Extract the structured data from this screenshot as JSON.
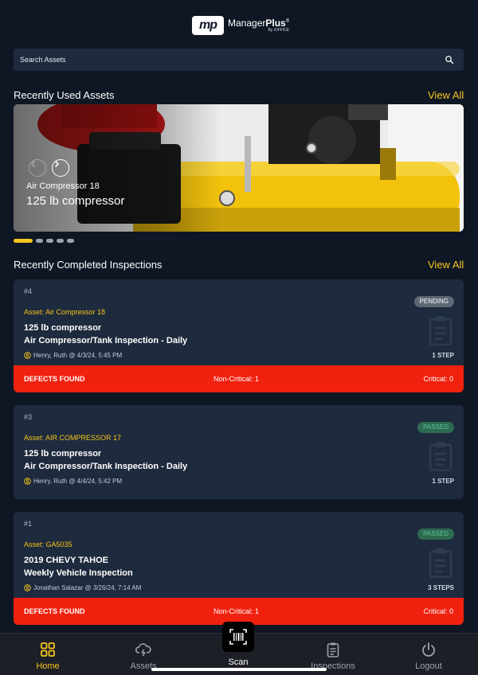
{
  "brand": {
    "mark": "mp",
    "name_light": "Manager",
    "name_bold": "Plus",
    "reg": "®",
    "byline": "By iOFFICE"
  },
  "search": {
    "placeholder": "Search Assets"
  },
  "recent_assets": {
    "title": "Recently Used Assets",
    "view_all": "View All",
    "slide": {
      "subtitle": "Air Compressor 18",
      "title": "125 lb compressor"
    },
    "pagination": {
      "count": 5,
      "active": 0
    }
  },
  "recent_inspections": {
    "title": "Recently Completed Inspections",
    "view_all": "View All",
    "cards": [
      {
        "number": "#4",
        "asset": "Asset: Air Compressor 18",
        "line1": "125 lb compressor",
        "line2": "Air Compressor/Tank Inspection - Daily",
        "meta": "Henry, Ruth @ 4/3/24, 5:45 PM",
        "status": "PENDING",
        "steps": "1 STEP",
        "defects": {
          "label": "DEFECTS FOUND",
          "non_critical": "Non-Critical: 1",
          "critical": "Critical: 0"
        }
      },
      {
        "number": "#3",
        "asset": "Asset: AIR COMPRESSOR 17",
        "line1": "125 lb compressor",
        "line2": "Air Compressor/Tank Inspection - Daily",
        "meta": "Henry, Ruth @ 4/4/24, 5:42 PM",
        "status": "PASSED",
        "steps": "1 STEP"
      },
      {
        "number": "#1",
        "asset": "Asset: GA5035",
        "line1": "2019 CHEVY TAHOE",
        "line2": "Weekly Vehicle Inspection",
        "meta": "Jonathan Salazar @ 3/26/24, 7:14 AM",
        "status": "PASSED",
        "steps": "3 STEPS",
        "defects": {
          "label": "DEFECTS FOUND",
          "non_critical": "Non-Critical: 1",
          "critical": "Critical: 0"
        }
      }
    ]
  },
  "tabs": {
    "home": "Home",
    "assets": "Assets",
    "scan": "Scan",
    "inspections": "Inspections",
    "logout": "Logout"
  },
  "colors": {
    "background": "#0f1725",
    "card": "#1e2a3d",
    "accent": "#f5c51b",
    "defects": "#f0210f",
    "passed": "#5ec490"
  },
  "icons": {
    "search": "search-icon",
    "next": "chevron-right-icon",
    "prev": "chevron-left-icon",
    "user": "user-circle-icon",
    "clipboard": "clipboard-icon",
    "home": "grid-icon",
    "assets": "cloud-lightning-icon",
    "scan": "barcode-icon",
    "inspections": "clipboard-list-icon",
    "logout": "power-icon"
  }
}
